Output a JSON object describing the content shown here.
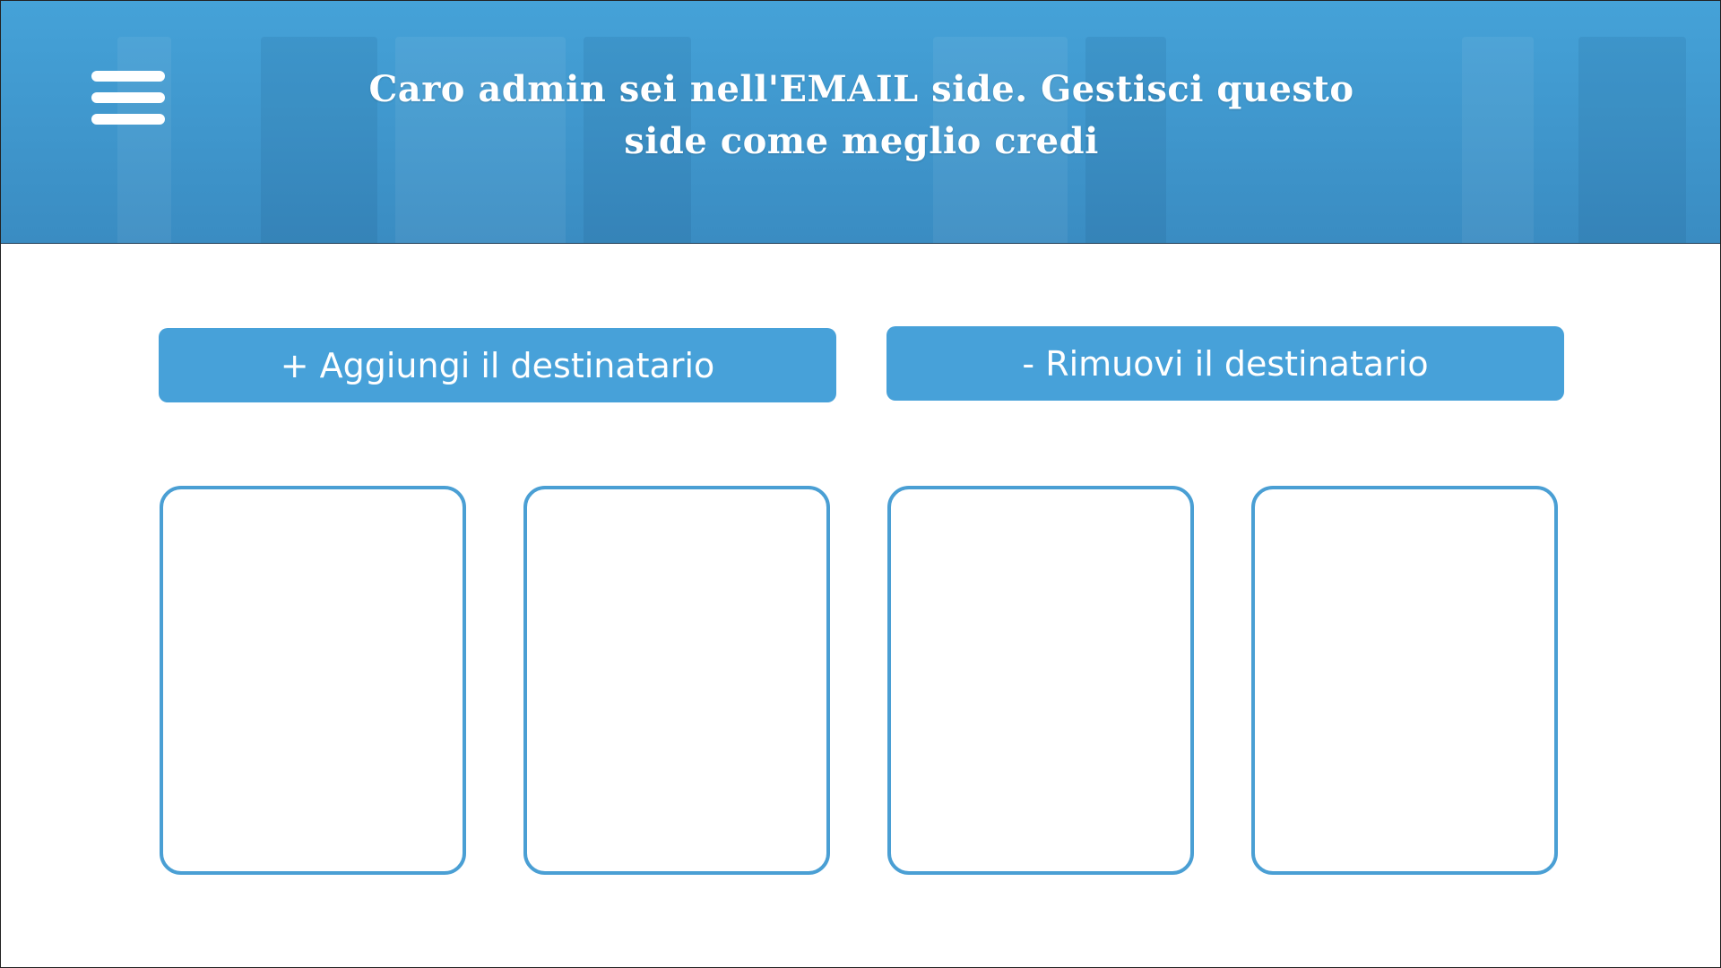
{
  "header": {
    "title": "Caro admin sei nell'EMAIL side. Gestisci questo side come meglio credi",
    "menu_icon": "hamburger-menu-icon"
  },
  "actions": {
    "add_label": "+ Aggiungi il destinatario",
    "remove_label": "- Rimuovi il destinatario"
  },
  "cards": [
    {
      "content": ""
    },
    {
      "content": ""
    },
    {
      "content": ""
    },
    {
      "content": ""
    }
  ],
  "colors": {
    "header_blue": "#45a2d8",
    "button_blue": "#47a1d9",
    "card_border": "#4a9fd4",
    "background": "#ffffff"
  }
}
